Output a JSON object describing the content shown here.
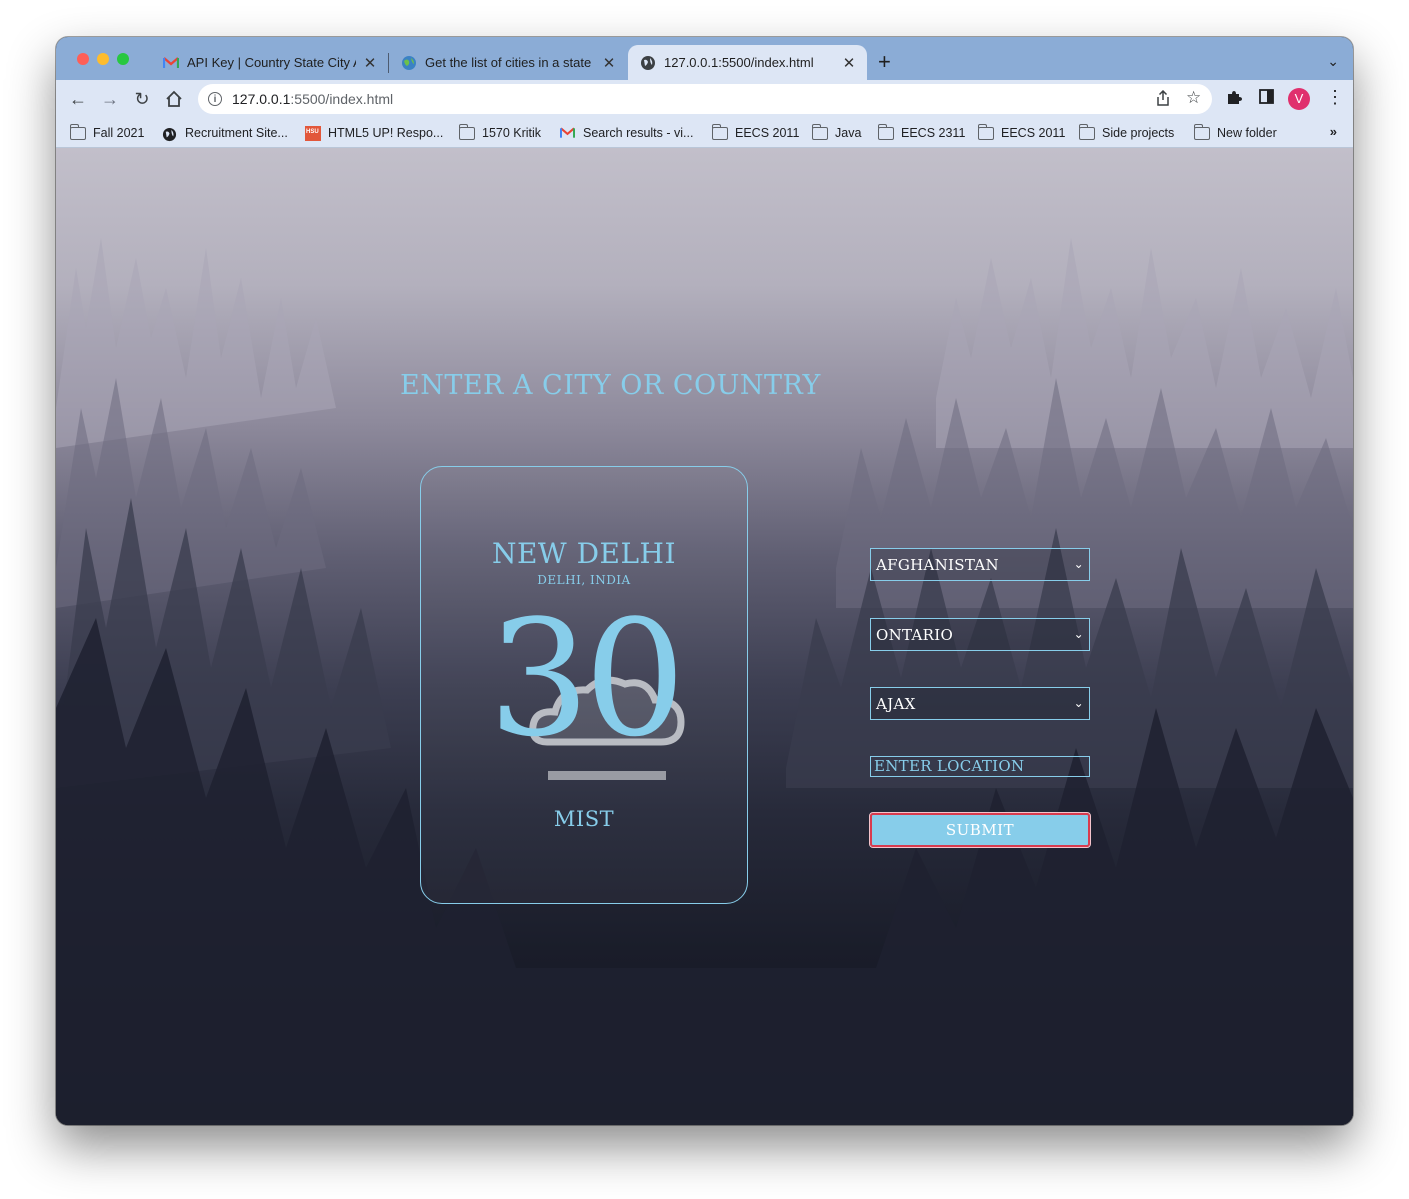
{
  "browser": {
    "tabs": [
      {
        "title": "API Key | Country State City AP",
        "icon": "gmail-icon"
      },
      {
        "title": "Get the list of cities in a state |",
        "icon": "globe-icon"
      },
      {
        "title": "127.0.0.1:5500/index.html",
        "icon": "globe-icon"
      }
    ],
    "new_tab": "+",
    "url_host": "127.0.0.1",
    "url_rest": ":5500/index.html",
    "avatar_letter": "V",
    "bookmarks": [
      {
        "label": "Fall 2021",
        "icon": "folder-icon"
      },
      {
        "label": "Recruitment Site...",
        "icon": "globe-icon"
      },
      {
        "label": "HTML5 UP! Respo...",
        "icon": "html5up-icon"
      },
      {
        "label": "1570 Kritik",
        "icon": "folder-icon"
      },
      {
        "label": "Search results - vi...",
        "icon": "gmail-icon"
      },
      {
        "label": "EECS 2011",
        "icon": "folder-icon"
      },
      {
        "label": "Java",
        "icon": "folder-icon"
      },
      {
        "label": "EECS 2311",
        "icon": "folder-icon"
      },
      {
        "label": "EECS 2011",
        "icon": "folder-icon"
      },
      {
        "label": "Side projects",
        "icon": "folder-icon"
      },
      {
        "label": "New folder",
        "icon": "folder-icon"
      }
    ],
    "bookmarks_overflow": "»"
  },
  "page": {
    "heading": "ENTER A CITY OR COUNTRY",
    "weather": {
      "city": "NEW DELHI",
      "region": "DELHI, INDIA",
      "temperature": "30",
      "icon": "mist-cloud-icon",
      "description": "MIST"
    },
    "form": {
      "country": "AFGHANISTAN",
      "state": "ONTARIO",
      "city": "AJAX",
      "location_placeholder": "ENTER LOCATION",
      "submit_label": "SUBMIT"
    },
    "accent_color": "#87cdea"
  }
}
